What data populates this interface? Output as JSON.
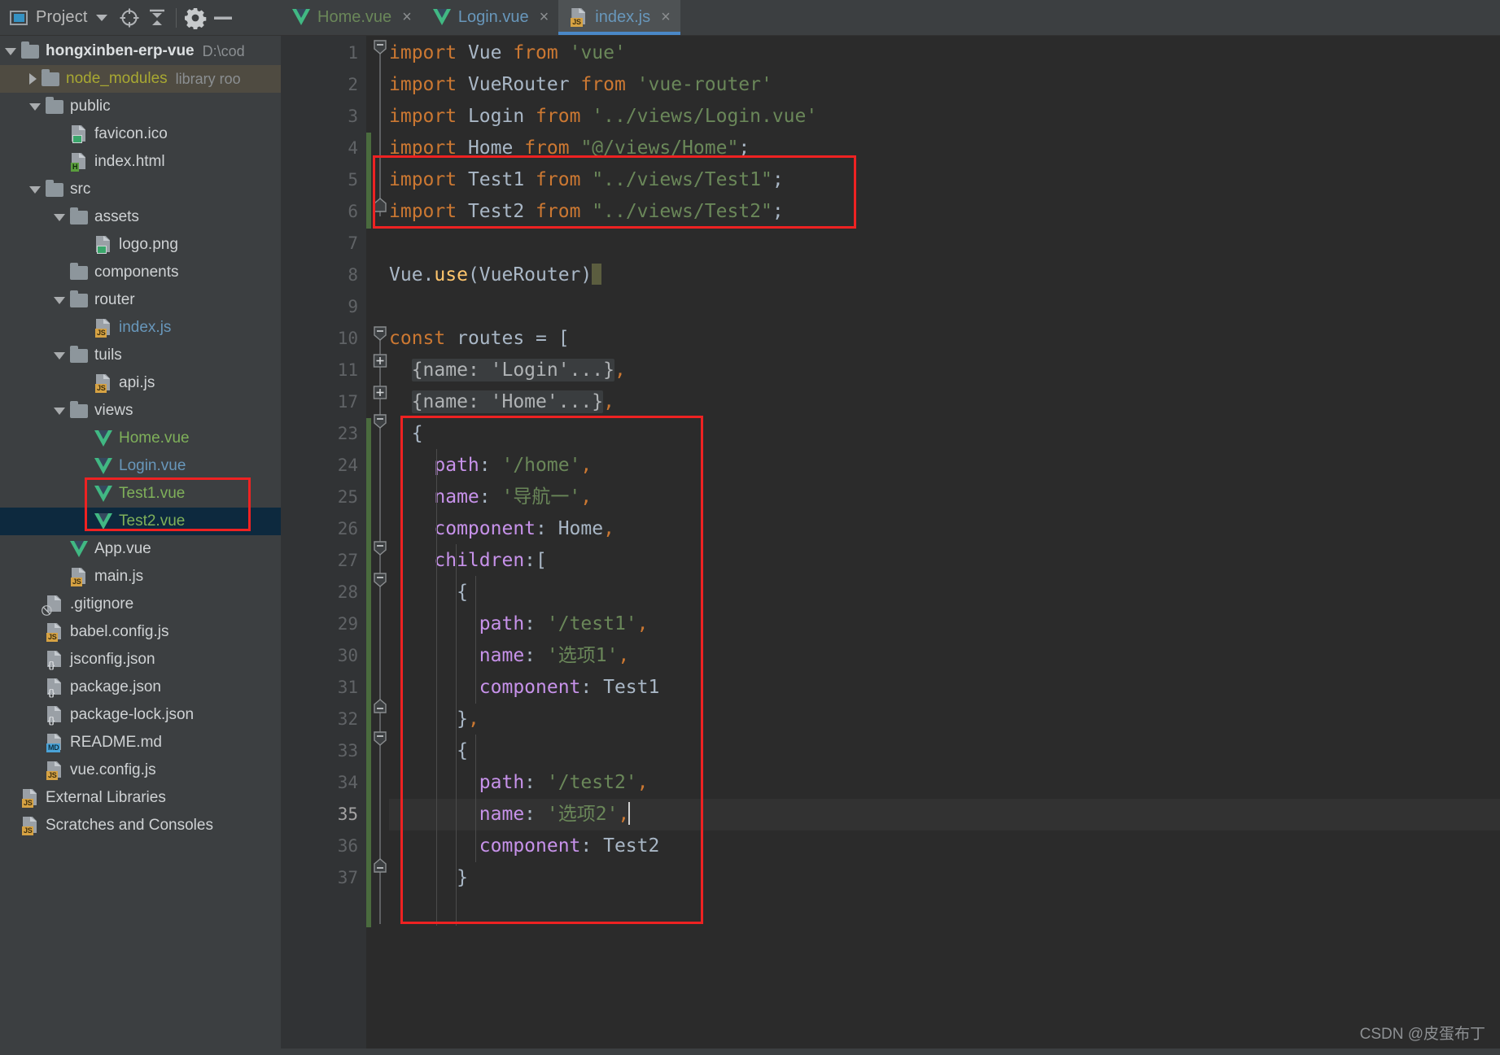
{
  "toolwindow": {
    "title": "Project",
    "icons": [
      "project-icon",
      "chevron-down-icon",
      "locate-icon",
      "collapse-all-icon",
      "settings-gear-icon",
      "hide-icon"
    ]
  },
  "tabs": [
    {
      "label": "Home.vue",
      "icon": "vue-file-icon",
      "color": "green",
      "active": false,
      "close": "×"
    },
    {
      "label": "Login.vue",
      "icon": "vue-file-icon",
      "color": "blue",
      "active": false,
      "close": "×"
    },
    {
      "label": "index.js",
      "icon": "js-file-icon",
      "color": "blue",
      "active": true,
      "close": "×"
    }
  ],
  "tree": [
    {
      "label": "hongxinben-erp-vue",
      "hint": "D:\\cod",
      "icon": "folder-icon",
      "arrow": "down",
      "depth": 0,
      "style": "bold"
    },
    {
      "label": "node_modules",
      "hint": "library roo",
      "icon": "folder-icon",
      "arrow": "right",
      "depth": 1,
      "style": "olive",
      "state": "hl"
    },
    {
      "label": "public",
      "hint": "",
      "icon": "folder-icon",
      "arrow": "down",
      "depth": 1,
      "style": "white"
    },
    {
      "label": "favicon.ico",
      "hint": "",
      "icon": "image-file-icon",
      "arrow": "none",
      "depth": 2,
      "style": "white"
    },
    {
      "label": "index.html",
      "hint": "",
      "icon": "html-file-icon",
      "arrow": "none",
      "depth": 2,
      "style": "white"
    },
    {
      "label": "src",
      "hint": "",
      "icon": "folder-icon",
      "arrow": "down",
      "depth": 1,
      "style": "white"
    },
    {
      "label": "assets",
      "hint": "",
      "icon": "folder-icon",
      "arrow": "down",
      "depth": 2,
      "style": "white"
    },
    {
      "label": "logo.png",
      "hint": "",
      "icon": "image-file-icon",
      "arrow": "none",
      "depth": 3,
      "style": "white"
    },
    {
      "label": "components",
      "hint": "",
      "icon": "folder-icon",
      "arrow": "none",
      "depth": 2,
      "style": "white"
    },
    {
      "label": "router",
      "hint": "",
      "icon": "folder-icon",
      "arrow": "down",
      "depth": 2,
      "style": "white"
    },
    {
      "label": "index.js",
      "hint": "",
      "icon": "js-file-icon",
      "arrow": "none",
      "depth": 3,
      "style": "blue"
    },
    {
      "label": "tuils",
      "hint": "",
      "icon": "folder-icon",
      "arrow": "down",
      "depth": 2,
      "style": "white"
    },
    {
      "label": "api.js",
      "hint": "",
      "icon": "js-file-icon",
      "arrow": "none",
      "depth": 3,
      "style": "white"
    },
    {
      "label": "views",
      "hint": "",
      "icon": "folder-icon",
      "arrow": "down",
      "depth": 2,
      "style": "white"
    },
    {
      "label": "Home.vue",
      "hint": "",
      "icon": "vue-file-icon",
      "arrow": "none",
      "depth": 3,
      "style": "green"
    },
    {
      "label": "Login.vue",
      "hint": "",
      "icon": "vue-file-icon",
      "arrow": "none",
      "depth": 3,
      "style": "blue"
    },
    {
      "label": "Test1.vue",
      "hint": "",
      "icon": "vue-file-icon",
      "arrow": "none",
      "depth": 3,
      "style": "green"
    },
    {
      "label": "Test2.vue",
      "hint": "",
      "icon": "vue-file-icon",
      "arrow": "none",
      "depth": 3,
      "style": "green",
      "state": "sel"
    },
    {
      "label": "App.vue",
      "hint": "",
      "icon": "vue-file-icon",
      "arrow": "none",
      "depth": 2,
      "style": "white"
    },
    {
      "label": "main.js",
      "hint": "",
      "icon": "js-file-icon",
      "arrow": "none",
      "depth": 2,
      "style": "white"
    },
    {
      "label": ".gitignore",
      "hint": "",
      "icon": "gitignore-file-icon",
      "arrow": "none",
      "depth": 1,
      "style": "white"
    },
    {
      "label": "babel.config.js",
      "hint": "",
      "icon": "js-file-icon",
      "arrow": "none",
      "depth": 1,
      "style": "white"
    },
    {
      "label": "jsconfig.json",
      "hint": "",
      "icon": "json-file-icon",
      "arrow": "none",
      "depth": 1,
      "style": "white"
    },
    {
      "label": "package.json",
      "hint": "",
      "icon": "json-file-icon",
      "arrow": "none",
      "depth": 1,
      "style": "white"
    },
    {
      "label": "package-lock.json",
      "hint": "",
      "icon": "json-file-icon",
      "arrow": "none",
      "depth": 1,
      "style": "white"
    },
    {
      "label": "README.md",
      "hint": "",
      "icon": "md-file-icon",
      "arrow": "none",
      "depth": 1,
      "style": "white"
    },
    {
      "label": "vue.config.js",
      "hint": "",
      "icon": "js-file-icon",
      "arrow": "none",
      "depth": 1,
      "style": "white"
    },
    {
      "label": "External Libraries",
      "hint": "",
      "icon": "external-libraries-icon",
      "arrow": "none",
      "depth": 0,
      "style": "white"
    },
    {
      "label": "Scratches and Consoles",
      "hint": "",
      "icon": "scratches-icon",
      "arrow": "none",
      "depth": 0,
      "style": "white"
    }
  ],
  "editor": {
    "line_numbers": [
      "1",
      "2",
      "3",
      "4",
      "5",
      "6",
      "7",
      "8",
      "9",
      "10",
      "11",
      "17",
      "23",
      "24",
      "25",
      "26",
      "27",
      "28",
      "29",
      "30",
      "31",
      "32",
      "33",
      "34",
      "35",
      "36",
      "37"
    ],
    "current_line_number": "35",
    "lines": [
      "import Vue from 'vue'",
      "import VueRouter from 'vue-router'",
      "import Login from '../views/Login.vue'",
      "import Home from \"@/views/Home\";",
      "import Test1 from \"../views/Test1\";",
      "import Test2 from \"../views/Test2\";",
      "",
      "Vue.use(VueRouter)",
      "",
      "const routes = [",
      "  {name: 'Login'...},",
      "  {name: 'Home'...},",
      "  {",
      "    path: '/home',",
      "    name: '导航一',",
      "    component: Home,",
      "    children:[",
      "      {",
      "        path: '/test1',",
      "        name: '选项1',",
      "        component: Test1",
      "      },",
      "      {",
      "        path: '/test2',",
      "        name: '选项2',",
      "        component: Test2",
      "      }"
    ],
    "folded_placeholders": [
      "{name: 'Login'...}",
      "{name: 'Home'...}"
    ],
    "annotations": [
      {
        "name": "import-highlight-box",
        "color": "#ee2222"
      },
      {
        "name": "route-object-highlight-box",
        "color": "#ee2222"
      }
    ]
  },
  "watermark": "CSDN @皮蛋布丁",
  "colors": {
    "accent_tab_underline": "#4a88c7",
    "annotation_red": "#ee2222",
    "editor_bg": "#2b2b2b",
    "panel_bg": "#3c3f41",
    "selection_bg": "#0d293e",
    "vue_green": "#41b883",
    "string_green": "#6a8759",
    "keyword_orange": "#cc7832"
  }
}
